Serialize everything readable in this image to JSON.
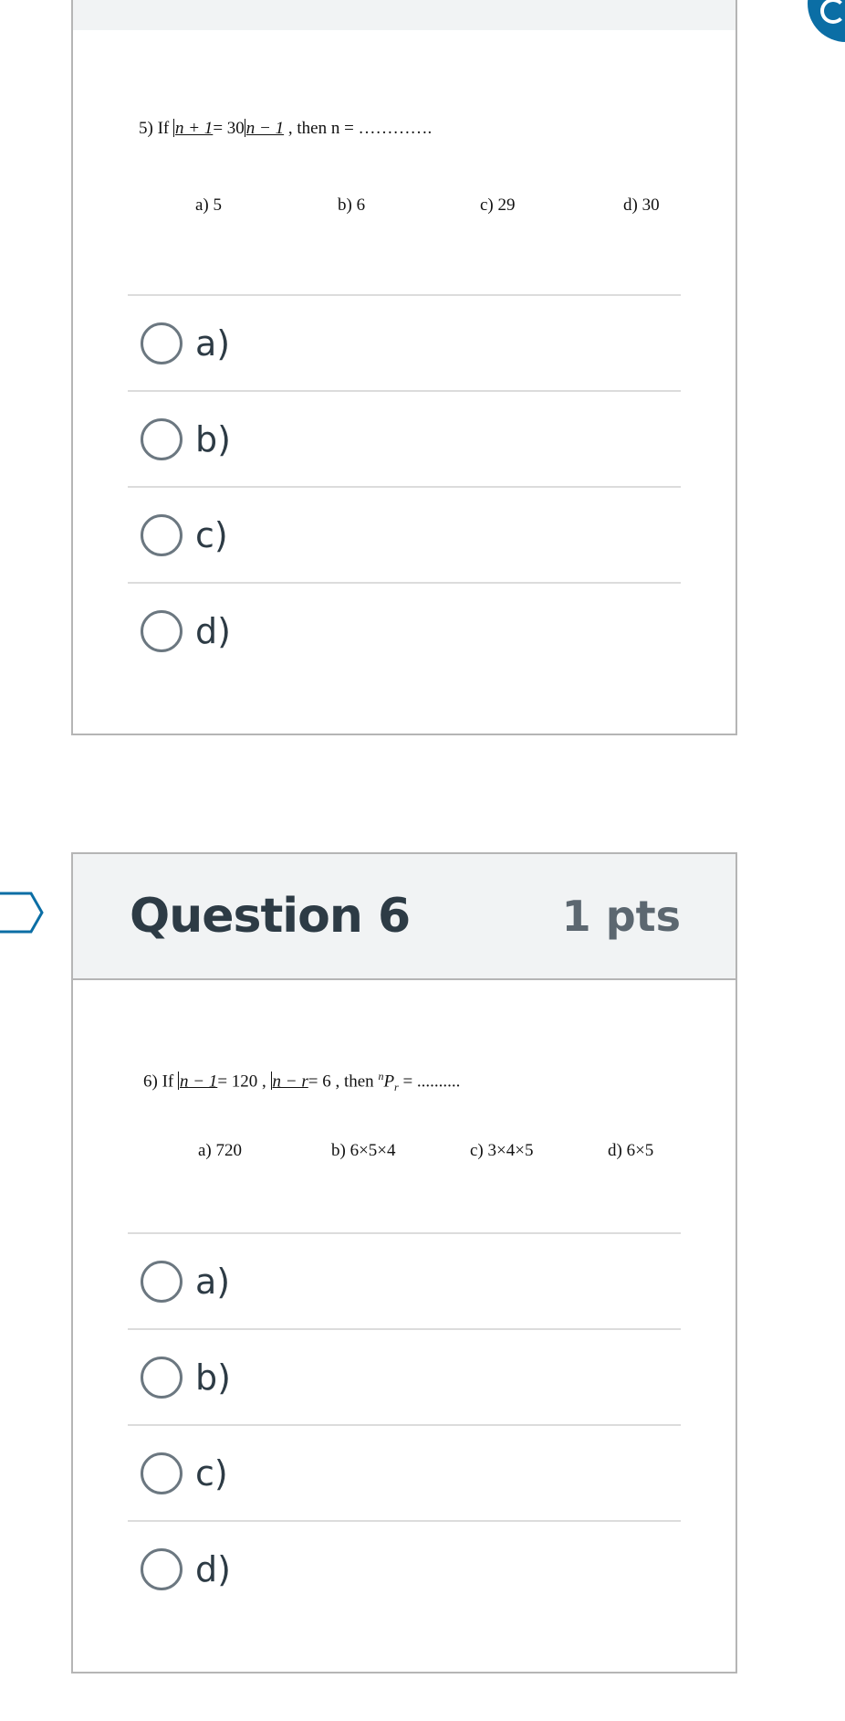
{
  "question5": {
    "stem_prefix": "5) If",
    "stem_f1": "n + 1",
    "stem_mid": "= 30",
    "stem_f2": "n − 1",
    "stem_suffix": ",  then n = ………….",
    "choices": [
      "a) 5",
      "b) 6",
      "c) 29",
      "d) 30"
    ],
    "answers": [
      "a)",
      "b)",
      "c)",
      "d)"
    ]
  },
  "question6": {
    "title": "Question 6",
    "points": "1 pts",
    "stem_prefix": "6) If",
    "stem_f1": "n − 1",
    "stem_mid": "= 120 ,",
    "stem_f2": "n − r",
    "stem_mid2": "= 6 , then",
    "stem_perm_n": "n",
    "stem_perm_P": "P",
    "stem_perm_r": "r",
    "stem_suffix": "= ..........",
    "choices": [
      "a) 720",
      "b) 6×5×4",
      "c)  3×4×5",
      "d)  6×5"
    ],
    "answers": [
      "a)",
      "b)",
      "c)",
      "d)"
    ]
  },
  "icons": {
    "flag": "flag-outline-icon",
    "corner": "help-icon"
  },
  "colors": {
    "header_bg": "#f1f3f4",
    "border": "#b5b5b5",
    "text": "#2d3b45",
    "pts": "#5c6770",
    "accent": "#0b6ea5"
  }
}
